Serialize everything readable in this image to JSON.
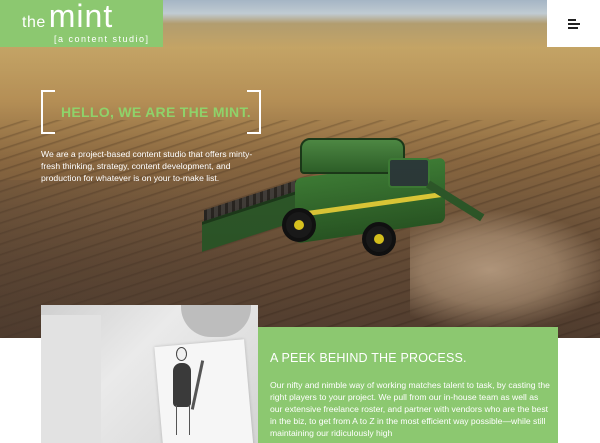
{
  "logo": {
    "the": "the",
    "mint": "mint",
    "tagline": "[a content studio]"
  },
  "menu": {
    "icon": "hamburger-menu-icon"
  },
  "hero": {
    "title": "HELLO, WE ARE THE MINT.",
    "description": "We are a project-based content studio that offers minty-fresh thinking, strategy, content development, and production for whatever is on your to-make list."
  },
  "process": {
    "title": "A PEEK BEHIND THE PROCESS.",
    "text": "Our nifty and nimble way of working matches talent to task, by casting the right players to your project. We pull from our in-house team as well as our extensive freelance roster, and partner with vendors who are the best in the biz, to get from A to Z in the most efficient way possible—while still maintaining our ridiculously high"
  },
  "colors": {
    "brand_green": "#8cc870",
    "title_green": "#8fd26a",
    "white": "#ffffff"
  }
}
